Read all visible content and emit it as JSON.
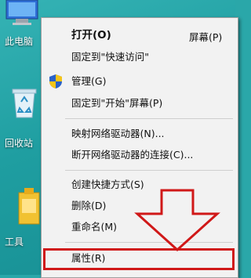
{
  "desktop": {
    "icons": [
      {
        "label": "此电脑",
        "icon": "computer-icon"
      },
      {
        "label": "回收站",
        "icon": "recycle-bin-icon"
      },
      {
        "label": "工具",
        "icon": "folder-icon"
      }
    ]
  },
  "context_menu": {
    "items": {
      "open": "打开(O)",
      "pin_start_partial": "屏幕(P)",
      "pin_quick_access": "固定到\"快速访问\"",
      "manage": "管理(G)",
      "pin_start": "固定到\"开始\"屏幕(P)",
      "map_drive": "映射网络驱动器(N)...",
      "disconnect_drive": "断开网络驱动器的连接(C)...",
      "create_shortcut": "创建快捷方式(S)",
      "delete": "删除(D)",
      "rename": "重命名(M)",
      "properties": "属性(R)"
    },
    "highlight_color": "#d01818"
  }
}
